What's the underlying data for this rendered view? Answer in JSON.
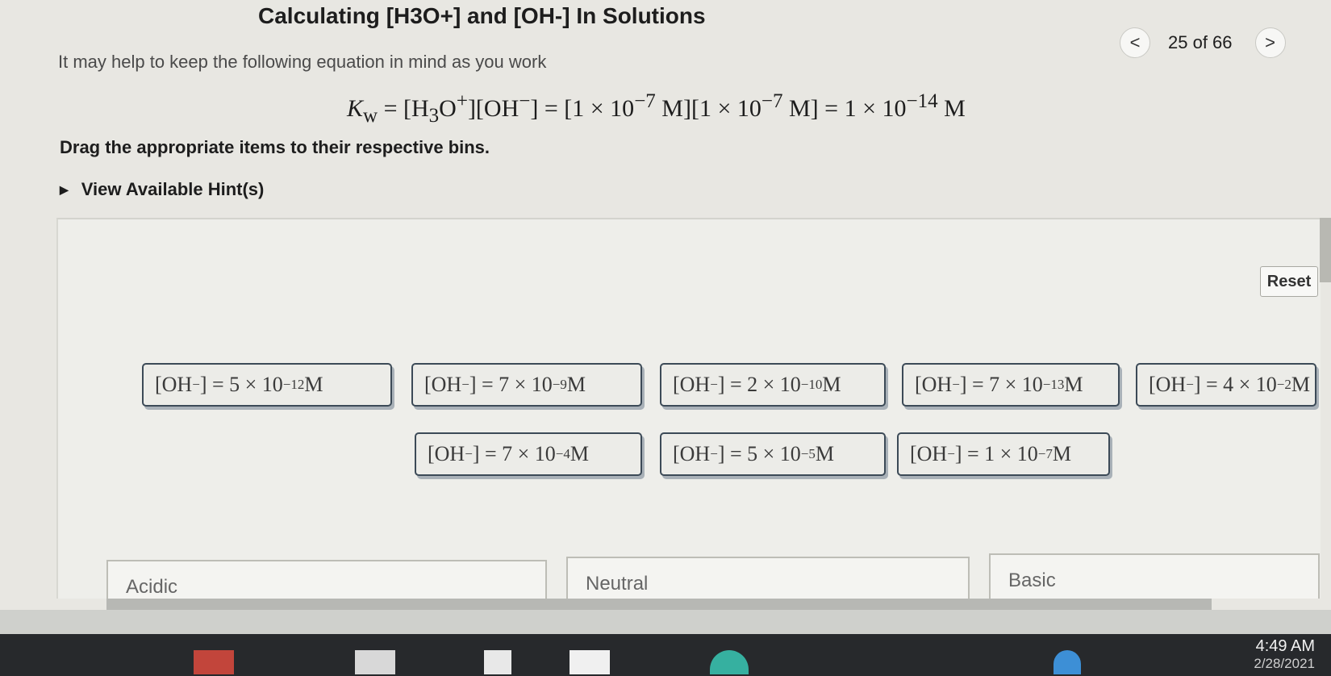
{
  "header": {
    "title": "Calculating [H3O+] and [OH-] In Solutions",
    "nav_prev": "<",
    "nav_next": ">",
    "page_count": "25 of 66"
  },
  "intro_text": "It may help to keep the following equation in mind as you work",
  "equation": {
    "k": "K",
    "sub": "w",
    "part1": " = [H",
    "sub3": "3",
    "part2": "O",
    "plus": "+",
    "part3": "][OH",
    "minus": "−",
    "part4": "] = [1 × 10",
    "exp1": "−7",
    "part5": " M][1 × 10",
    "exp2": "−7",
    "part6": " M] = 1 × 10",
    "exp3": "−14",
    "part7": " M"
  },
  "instruction": "Drag the appropriate items to their respective bins.",
  "hint": "View Available Hint(s)",
  "reset_label": "Reset",
  "tiles": [
    {
      "lhs": "[OH",
      "lhs_sup": "−",
      "rhs": "] = 5 × 10",
      "exp": "−12",
      "unit": " M"
    },
    {
      "lhs": "[OH",
      "lhs_sup": "−",
      "rhs": "] = 7 × 10",
      "exp": "−9",
      "unit": " M"
    },
    {
      "lhs": "[OH",
      "lhs_sup": "−",
      "rhs": "] = 2 × 10",
      "exp": "−10",
      "unit": " M"
    },
    {
      "lhs": "[OH",
      "lhs_sup": "−",
      "rhs": "] = 7 × 10",
      "exp": "−13",
      "unit": " M"
    },
    {
      "lhs": "[OH",
      "lhs_sup": "−",
      "rhs": "] = 4 × 10",
      "exp": "−2",
      "unit": " M"
    },
    {
      "lhs": "[OH",
      "lhs_sup": "−",
      "rhs": "] = 7 × 10",
      "exp": "−4",
      "unit": " M"
    },
    {
      "lhs": "[OH",
      "lhs_sup": "−",
      "rhs": "] = 5 × 10",
      "exp": "−5",
      "unit": " M"
    },
    {
      "lhs": "[OH",
      "lhs_sup": "−",
      "rhs": "] = 1 × 10",
      "exp": "−7",
      "unit": " M"
    }
  ],
  "bins": [
    "Acidic",
    "Neutral",
    "Basic"
  ],
  "clock": {
    "time": "4:49 AM",
    "date": "2/28/2021"
  }
}
